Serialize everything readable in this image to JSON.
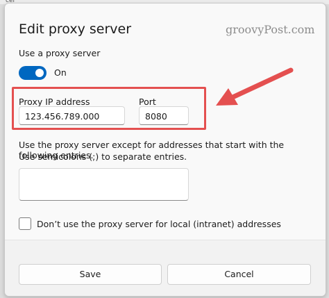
{
  "background": {
    "strip_text": "cer"
  },
  "dialog": {
    "title": "Edit proxy server",
    "watermark": "groovyPost.com",
    "use_proxy_label": "Use a proxy server",
    "toggle": {
      "state": "On",
      "on": true
    },
    "proxy_ip": {
      "label": "Proxy IP address",
      "value": "123.456.789.000"
    },
    "port": {
      "label": "Port",
      "value": "8080"
    },
    "exceptions_description": [
      "Use the proxy server except for addresses that start with the following entries.",
      "Use semicolons (;) to separate entries."
    ],
    "exceptions_value": "",
    "local_checkbox": {
      "label": "Don’t use the proxy server for local (intranet) addresses",
      "checked": false
    },
    "buttons": {
      "save": "Save",
      "cancel": "Cancel"
    }
  },
  "colors": {
    "accent": "#0067c0",
    "annotation": "#e45050"
  },
  "icons": [
    "red-arrow-annotation-icon"
  ]
}
